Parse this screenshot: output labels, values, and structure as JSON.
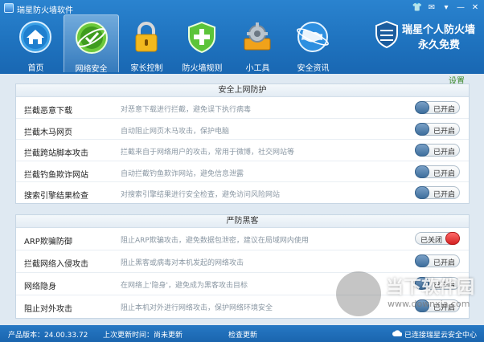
{
  "window": {
    "title": "瑞星防火墙软件",
    "controls": [
      "👕",
      "✉",
      "▾",
      "—",
      "✕"
    ]
  },
  "nav": {
    "items": [
      {
        "label": "首页",
        "icon": "home-icon"
      },
      {
        "label": "网络安全",
        "icon": "network-security-icon",
        "active": true
      },
      {
        "label": "家长控制",
        "icon": "lock-icon"
      },
      {
        "label": "防火墙规则",
        "icon": "shield-icon"
      },
      {
        "label": "小工具",
        "icon": "gear-toolbox-icon"
      },
      {
        "label": "安全资讯",
        "icon": "globe-icon"
      }
    ]
  },
  "promo": {
    "line1": "瑞星个人防火墙",
    "line2": "永久免费"
  },
  "settings_label": "设置",
  "sections": [
    {
      "title": "安全上网防护",
      "rows": [
        {
          "title": "拦截恶意下载",
          "desc": "对恶意下载进行拦截，避免误下执行病毒",
          "state": "已开启",
          "on": true
        },
        {
          "title": "拦截木马网页",
          "desc": "自动阻止网页木马攻击，保护电脑",
          "state": "已开启",
          "on": true
        },
        {
          "title": "拦截跨站脚本攻击",
          "desc": "拦截来自于网络用户的攻击，常用于微博，社交网站等",
          "state": "已开启",
          "on": true
        },
        {
          "title": "拦截钓鱼欺诈网站",
          "desc": "自动拦截钓鱼欺诈网站，避免信息泄露",
          "state": "已开启",
          "on": true
        },
        {
          "title": "搜索引擎结果检查",
          "desc": "对搜索引擎结果进行安全检查，避免访问风险网站",
          "state": "已开启",
          "on": true
        }
      ]
    },
    {
      "title": "严防黑客",
      "rows": [
        {
          "title": "ARP欺骗防御",
          "desc": "阻止ARP欺骗攻击，避免数据包泄密，建议在局域网内使用",
          "state": "已关闭",
          "on": false
        },
        {
          "title": "拦截网络入侵攻击",
          "desc": "阻止黑客或病毒对本机发起的网络攻击",
          "state": "已开启",
          "on": true
        },
        {
          "title": "网络隐身",
          "desc": "在网络上'隐身'，避免成为黑客攻击目标",
          "state": "已开启",
          "on": true
        },
        {
          "title": "阻止对外攻击",
          "desc": "阻止本机对外进行网络攻击，保护网络环境安全",
          "state": "已开启",
          "on": true
        }
      ]
    }
  ],
  "footer": {
    "version": "产品版本：24.00.33.72",
    "last_update": "上次更新时间：尚未更新",
    "check_update": "检查更新",
    "cloud_status": "已连接瑞星云安全中心"
  },
  "watermark": {
    "text1": "当下软件园",
    "text2": "www.downxia.com"
  },
  "colors": {
    "header": "#1f73bf",
    "toggle_on": "#3d6e9c",
    "toggle_off": "#d42222",
    "settings": "#3d8a2a"
  }
}
